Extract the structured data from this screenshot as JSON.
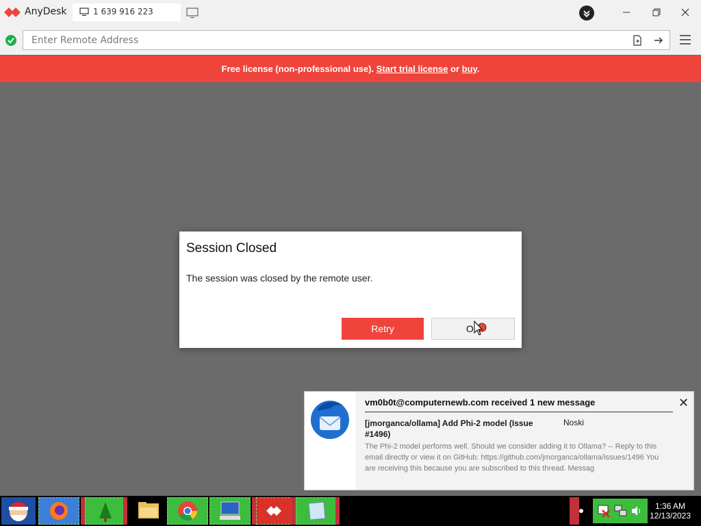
{
  "app": {
    "title": "AnyDesk"
  },
  "tab": {
    "label": "1 639 916 223"
  },
  "address": {
    "placeholder": "Enter Remote Address",
    "value": ""
  },
  "banner": {
    "text_prefix": "Free license (non-professional use). ",
    "trial_link": "Start trial license",
    "or_text": " or ",
    "buy_link": "buy",
    "suffix": "."
  },
  "dialog": {
    "title": "Session Closed",
    "message": "The session was closed by the remote user.",
    "retry_label": "Retry",
    "ok_label": "OK"
  },
  "notification": {
    "title": "vm0b0t@computernewb.com received 1 new message",
    "subject": "[jmorganca/ollama] Add Phi-2 model (Issue #1496)",
    "sender": "Noski",
    "body": "The Phi-2 model performs well. Should we consider adding it to Ollama? -- Reply to this email directly or view it on GitHub: https://github.com/jmorganca/ollama/issues/1496 You are receiving this because you are subscribed to this thread. Messag",
    "close_glyph": "✕"
  },
  "taskbar": {
    "time": "1:36 AM",
    "date": "12/13/2023"
  },
  "colors": {
    "brand_red": "#ef443b",
    "online_green": "#1cae4d",
    "taskbar_green": "#3dbd3d"
  }
}
